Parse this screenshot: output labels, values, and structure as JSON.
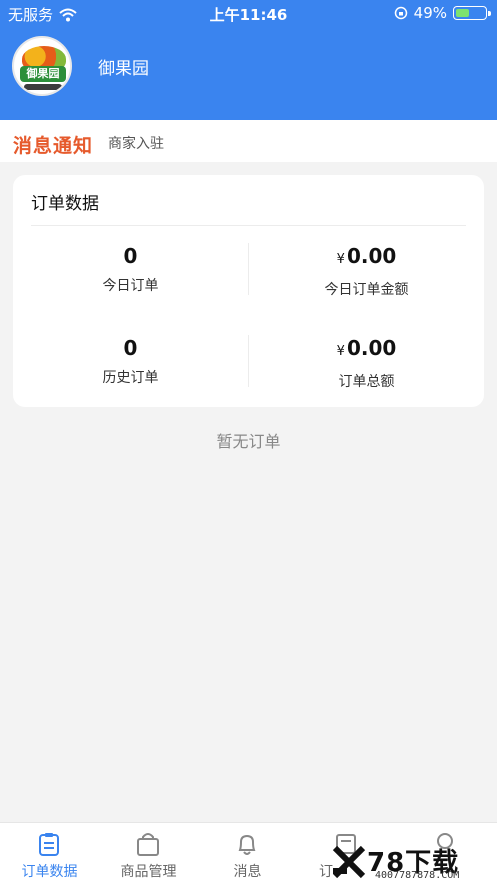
{
  "status_bar": {
    "carrier": "无服务",
    "time": "上午11:46",
    "battery": "49%",
    "battery_level": 0.49
  },
  "header": {
    "logo_text": "御果园",
    "shop_name": "御果园"
  },
  "notice": {
    "tag": "消息通知",
    "message": "商家入驻"
  },
  "order_card": {
    "title": "订单数据",
    "stats": [
      {
        "value": "0",
        "label": "今日订单"
      },
      {
        "currency": "¥",
        "value": "0.00",
        "label": "今日订单金额"
      },
      {
        "value": "0",
        "label": "历史订单"
      },
      {
        "currency": "¥",
        "value": "0.00",
        "label": "订单总额"
      }
    ]
  },
  "empty_text": "暂无订单",
  "tabs": [
    {
      "label": "订单数据",
      "icon": "clipboard-icon",
      "active": true
    },
    {
      "label": "商品管理",
      "icon": "shopping-bag-icon",
      "active": false
    },
    {
      "label": "消息",
      "icon": "bell-icon",
      "active": false
    },
    {
      "label": "订",
      "icon": "document-icon",
      "active": false
    },
    {
      "label": "",
      "icon": "user-icon",
      "active": false
    }
  ],
  "watermark": {
    "brand": "78下载",
    "site": "4007787878.COM"
  },
  "colors": {
    "primary": "#3a84ef",
    "accent_orange": "#e65a2c",
    "background": "#f3f3f3"
  }
}
